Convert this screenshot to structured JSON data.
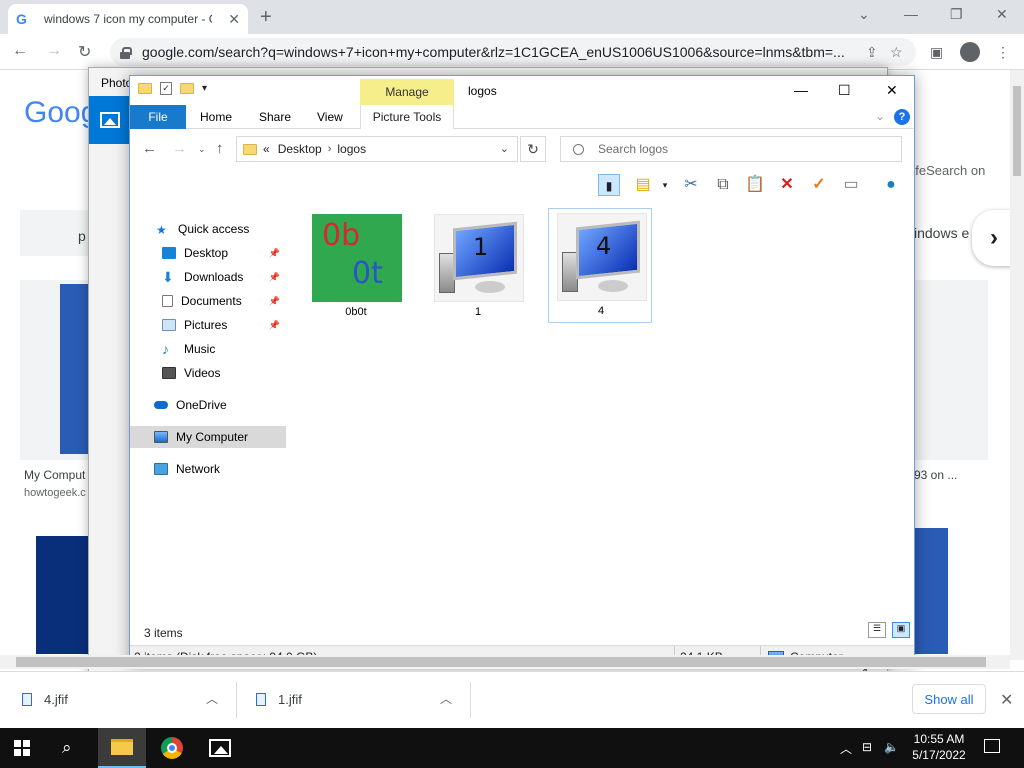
{
  "browser": {
    "tab_title": "windows 7 icon my computer - G",
    "url": "google.com/search?q=windows+7+icon+my+computer&rlz=1C1GCEA_enUS1006US1006&source=lnms&tbm=...",
    "safesearch": "afeSearch on",
    "windows_label": "indows e",
    "card_label_p": "p",
    "caption_left": "My Comput",
    "source_left": "howtogeek.c",
    "caption_right": "93 on ..."
  },
  "downloads": {
    "items": [
      {
        "name": "4.jfif"
      },
      {
        "name": "1.jfif"
      }
    ],
    "show_all": "Show all"
  },
  "photos_window": {
    "title": "Photo"
  },
  "explorer": {
    "title": "logos",
    "manage_label": "Manage",
    "tabs": {
      "file": "File",
      "home": "Home",
      "share": "Share",
      "view": "View",
      "picture_tools": "Picture Tools"
    },
    "address": {
      "overflow": "«",
      "crumbs": [
        "Desktop",
        "logos"
      ]
    },
    "search_placeholder": "Search logos",
    "nav": [
      {
        "label": "Quick access",
        "icon": "star-icon"
      },
      {
        "label": "Desktop",
        "icon": "desktop-icon",
        "pinned": true
      },
      {
        "label": "Downloads",
        "icon": "download-icon",
        "pinned": true
      },
      {
        "label": "Documents",
        "icon": "document-icon",
        "pinned": true
      },
      {
        "label": "Pictures",
        "icon": "pictures-icon",
        "pinned": true
      },
      {
        "label": "Music",
        "icon": "music-icon"
      },
      {
        "label": "Videos",
        "icon": "video-icon"
      },
      {
        "label": "OneDrive",
        "icon": "cloud-icon"
      },
      {
        "label": "My Computer",
        "icon": "computer-icon",
        "selected": true
      },
      {
        "label": "Network",
        "icon": "network-icon"
      }
    ],
    "files": [
      {
        "name": "0b0t"
      },
      {
        "name": "1",
        "digit": "1"
      },
      {
        "name": "4",
        "digit": "4",
        "selected": true
      }
    ],
    "thumb_text": {
      "line1": "0b",
      "line2": "0t"
    },
    "items_count": "3 items",
    "status": {
      "selection": "2 items (Disk free space: 94.0 GB)",
      "size": "24.1 KB",
      "location": "Computer"
    }
  },
  "taskbar": {
    "time": "10:55 AM",
    "date": "5/17/2022"
  },
  "colors": {
    "file_tab": "#1979ca",
    "manage": "#f5ee8a",
    "taskbar": "#101010",
    "accent": "#1a73e8"
  }
}
